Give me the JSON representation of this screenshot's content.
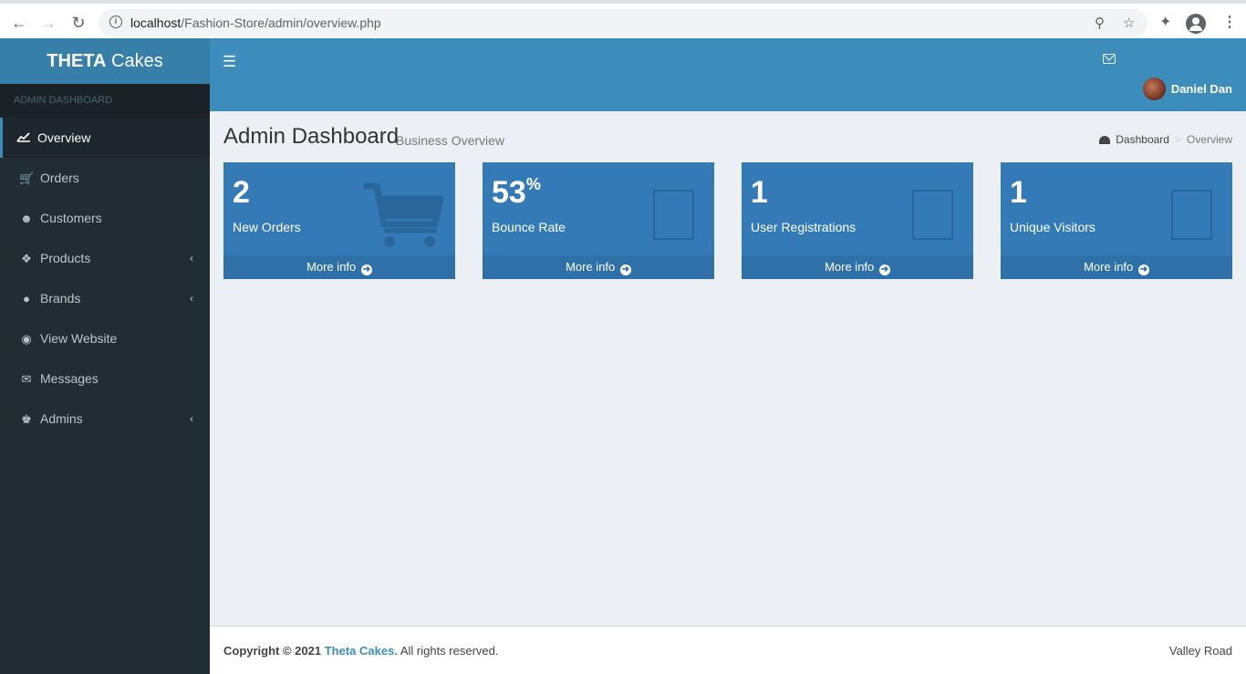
{
  "browser": {
    "url_host": "localhost",
    "url_path": "/Fashion-Store/admin/overview.php"
  },
  "brand": {
    "bold": "THETA",
    "rest": " Cakes"
  },
  "sidebar": {
    "header": "ADMIN DASHBOARD",
    "items": [
      {
        "label": "Overview",
        "icon": "line-chart-icon",
        "active": true
      },
      {
        "label": "Orders",
        "icon": "cart-icon"
      },
      {
        "label": "Customers",
        "icon": "user-icon"
      },
      {
        "label": "Products",
        "icon": "cubes-icon",
        "has_children": true
      },
      {
        "label": "Brands",
        "icon": "apple-icon",
        "has_children": true
      },
      {
        "label": "View Website",
        "icon": "globe-icon"
      },
      {
        "label": "Messages",
        "icon": "envelope-icon"
      },
      {
        "label": "Admins",
        "icon": "admin-icon",
        "has_children": true
      }
    ]
  },
  "navbar": {
    "user_name": "Daniel Dan"
  },
  "header": {
    "title": "Admin Dashboard",
    "subtitle": "Business Overview",
    "breadcrumb": {
      "home": "Dashboard",
      "current": "Overview"
    }
  },
  "boxes": [
    {
      "number": "2",
      "suffix": "",
      "label": "New Orders",
      "link": "More info"
    },
    {
      "number": "53",
      "suffix": "%",
      "label": "Bounce Rate",
      "link": "More info"
    },
    {
      "number": "1",
      "suffix": "",
      "label": "User Registrations",
      "link": "More info"
    },
    {
      "number": "1",
      "suffix": "",
      "label": "Unique Visitors",
      "link": "More info"
    }
  ],
  "footer": {
    "copyright_prefix": "Copyright © 2021",
    "brand": "Theta Cakes.",
    "suffix": "All rights reserved.",
    "right": "Valley Road"
  },
  "colors": {
    "navbar": "#3c8dbc",
    "logo": "#367fa9",
    "sidebar": "#222d32",
    "box": "#337ab7",
    "content_bg": "#ecf0f5"
  }
}
